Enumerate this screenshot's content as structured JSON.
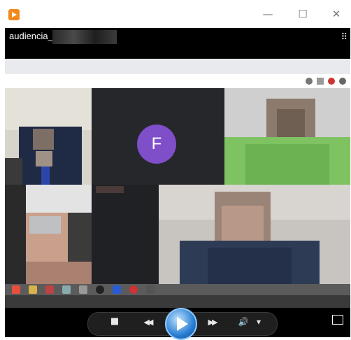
{
  "window": {
    "close_glyph": "✕",
    "maximize_glyph": "☐",
    "minimize_glyph": "—"
  },
  "player": {
    "file_title": "audiencia_",
    "layout_glyph": "⠿",
    "participant_initial": "F"
  },
  "controls": {
    "stop_glyph": "■",
    "prev_glyph": "◀◀",
    "next_glyph": "▶▶",
    "volume_glyph": "🔊",
    "volume_menu_glyph": "▾"
  },
  "colors": {
    "accent": "#2a7fd4",
    "avatar": "#7f4ec9",
    "app_icon": "#f28a1b"
  }
}
